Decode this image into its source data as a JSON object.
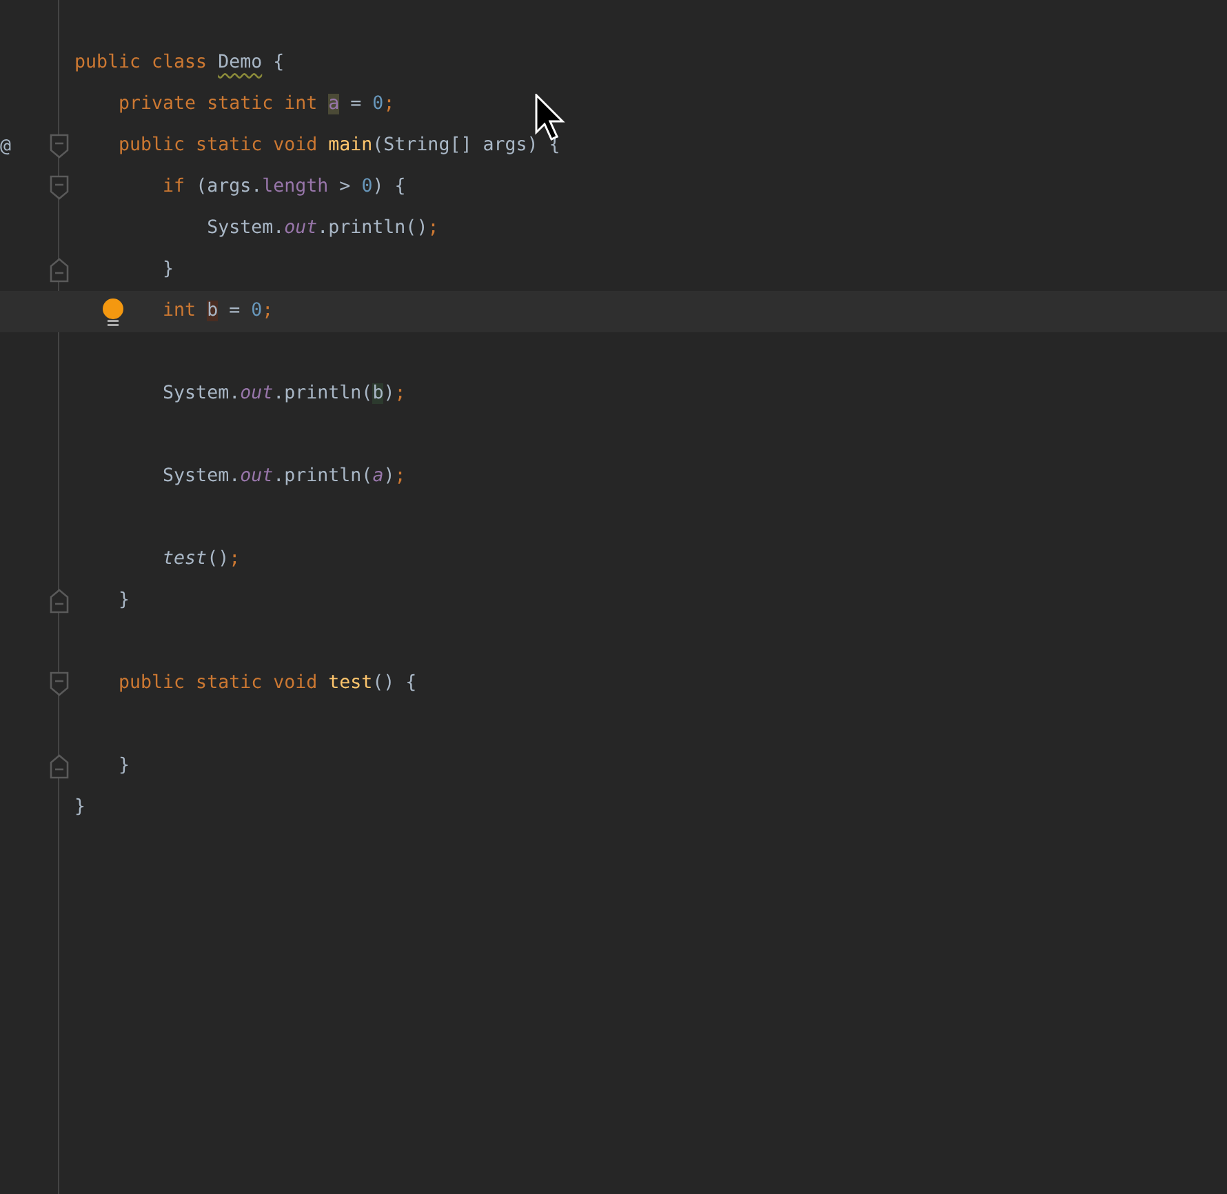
{
  "editor": {
    "lines": [
      {
        "kind": "code",
        "current": false,
        "bulb": false,
        "fold_open": false,
        "fold_close": false,
        "tokens": [
          {
            "kind": "keyword",
            "text": "public class "
          },
          {
            "kind": "class_name_warning",
            "text": "Demo"
          },
          {
            "kind": "plain",
            "text": " {"
          }
        ]
      },
      {
        "kind": "code",
        "current": false,
        "bulb": false,
        "fold_open": false,
        "fold_close": false,
        "tokens": [
          {
            "kind": "keyword",
            "text": "    private static int "
          },
          {
            "kind": "field_write",
            "text": "a"
          },
          {
            "kind": "plain",
            "text": " = "
          },
          {
            "kind": "number",
            "text": "0"
          },
          {
            "kind": "separator",
            "text": ";"
          }
        ]
      },
      {
        "kind": "code",
        "current": false,
        "bulb": false,
        "fold_open": true,
        "fold_close": false,
        "gutter_mark": "@",
        "tokens": [
          {
            "kind": "keyword",
            "text": "    public static void "
          },
          {
            "kind": "method_decl",
            "text": "main"
          },
          {
            "kind": "plain",
            "text": "(String[] args) {"
          }
        ]
      },
      {
        "kind": "code",
        "current": false,
        "bulb": false,
        "fold_open": true,
        "fold_close": false,
        "tokens": [
          {
            "kind": "keyword",
            "text": "        if "
          },
          {
            "kind": "plain",
            "text": "(args."
          },
          {
            "kind": "field",
            "text": "length"
          },
          {
            "kind": "plain",
            "text": " > "
          },
          {
            "kind": "number",
            "text": "0"
          },
          {
            "kind": "plain",
            "text": ") {"
          }
        ]
      },
      {
        "kind": "code",
        "current": false,
        "bulb": false,
        "fold_open": false,
        "fold_close": false,
        "tokens": [
          {
            "kind": "plain",
            "text": "            System."
          },
          {
            "kind": "static_field",
            "text": "out"
          },
          {
            "kind": "plain",
            "text": ".println()"
          },
          {
            "kind": "separator",
            "text": ";"
          }
        ]
      },
      {
        "kind": "code",
        "current": false,
        "bulb": false,
        "fold_open": false,
        "fold_close": true,
        "tokens": [
          {
            "kind": "plain",
            "text": "        }"
          }
        ]
      },
      {
        "kind": "code",
        "current": true,
        "bulb": true,
        "fold_open": false,
        "fold_close": false,
        "tokens": [
          {
            "kind": "keyword",
            "text": "        int "
          },
          {
            "kind": "local_write",
            "text": "b"
          },
          {
            "kind": "plain",
            "text": " = "
          },
          {
            "kind": "number",
            "text": "0"
          },
          {
            "kind": "separator",
            "text": ";"
          }
        ]
      },
      {
        "kind": "blank"
      },
      {
        "kind": "code",
        "current": false,
        "bulb": false,
        "fold_open": false,
        "fold_close": false,
        "tokens": [
          {
            "kind": "plain",
            "text": "        System."
          },
          {
            "kind": "static_field",
            "text": "out"
          },
          {
            "kind": "plain",
            "text": ".println("
          },
          {
            "kind": "local_read",
            "text": "b"
          },
          {
            "kind": "plain",
            "text": ")"
          },
          {
            "kind": "separator",
            "text": ";"
          }
        ]
      },
      {
        "kind": "blank"
      },
      {
        "kind": "code",
        "current": false,
        "bulb": false,
        "fold_open": false,
        "fold_close": false,
        "tokens": [
          {
            "kind": "plain",
            "text": "        System."
          },
          {
            "kind": "static_field",
            "text": "out"
          },
          {
            "kind": "plain",
            "text": ".println("
          },
          {
            "kind": "static_field",
            "text": "a"
          },
          {
            "kind": "plain",
            "text": ")"
          },
          {
            "kind": "separator",
            "text": ";"
          }
        ]
      },
      {
        "kind": "blank"
      },
      {
        "kind": "code",
        "current": false,
        "bulb": false,
        "fold_open": false,
        "fold_close": false,
        "tokens": [
          {
            "kind": "static_call",
            "text": "        test"
          },
          {
            "kind": "plain",
            "text": "()"
          },
          {
            "kind": "separator",
            "text": ";"
          }
        ]
      },
      {
        "kind": "code",
        "current": false,
        "bulb": false,
        "fold_open": false,
        "fold_close": true,
        "tokens": [
          {
            "kind": "plain",
            "text": "    }"
          }
        ]
      },
      {
        "kind": "blank"
      },
      {
        "kind": "code",
        "current": false,
        "bulb": false,
        "fold_open": true,
        "fold_close": false,
        "tokens": [
          {
            "kind": "keyword",
            "text": "    public static void "
          },
          {
            "kind": "method_decl",
            "text": "test"
          },
          {
            "kind": "plain",
            "text": "() {"
          }
        ]
      },
      {
        "kind": "blank"
      },
      {
        "kind": "code",
        "current": false,
        "bulb": false,
        "fold_open": false,
        "fold_close": true,
        "tokens": [
          {
            "kind": "plain",
            "text": "    }"
          }
        ]
      },
      {
        "kind": "code",
        "current": false,
        "bulb": false,
        "fold_open": false,
        "fold_close": false,
        "tokens": [
          {
            "kind": "plain",
            "text": "}"
          }
        ]
      }
    ]
  }
}
